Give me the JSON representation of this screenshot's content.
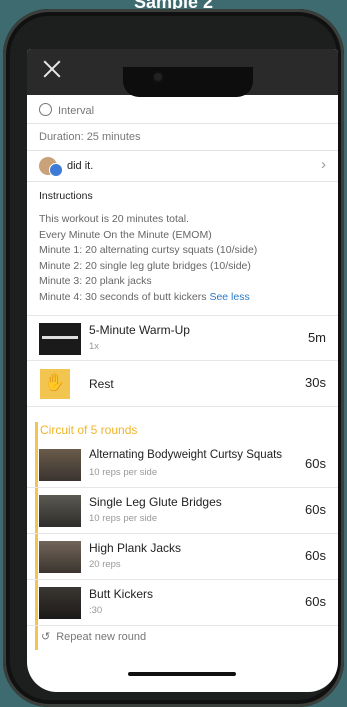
{
  "caption": "Sample 2",
  "header": {
    "type": "Interval",
    "duration": "Duration: 25 minutes",
    "did_it": "did it."
  },
  "instructions": {
    "title": "Instructions",
    "lines": [
      "This workout is 20 minutes total.",
      "Every Minute On the Minute (EMOM)",
      "Minute 1: 20 alternating curtsy squats (10/side)",
      "Minute 2: 20 single leg glute bridges (10/side)",
      "Minute 3: 20 plank jacks",
      "Minute 4: 30 seconds of butt kickers"
    ],
    "see_less": "See less"
  },
  "warmup": {
    "name": "5-Minute Warm-Up",
    "sub": "1x",
    "duration": "5m"
  },
  "rest": {
    "name": "Rest",
    "duration": "30s"
  },
  "circuit": {
    "title": "Circuit of 5 rounds",
    "items": [
      {
        "name": "Alternating Bodyweight Curtsy Squats",
        "sub": "10 reps per side",
        "duration": "60s"
      },
      {
        "name": "Single Leg Glute Bridges",
        "sub": "10 reps per side",
        "duration": "60s"
      },
      {
        "name": "High Plank Jacks",
        "sub": "20 reps",
        "duration": "60s"
      },
      {
        "name": "Butt Kickers",
        "sub": ":30",
        "duration": "60s"
      }
    ],
    "repeat": "Repeat new round"
  },
  "colors": {
    "accent": "#f1c550",
    "link": "#2a79c9",
    "bezel": "#1d1f1e",
    "background": "#3d6b6f"
  }
}
